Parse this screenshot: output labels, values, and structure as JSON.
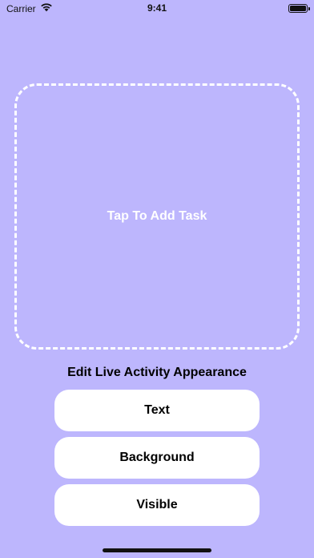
{
  "status_bar": {
    "carrier": "Carrier",
    "time": "9:41",
    "wifi_icon": "wifi-icon",
    "battery_icon": "battery-icon"
  },
  "drop_zone": {
    "label": "Tap To Add Task"
  },
  "appearance": {
    "title": "Edit Live Activity Appearance",
    "buttons": [
      {
        "label": "Text"
      },
      {
        "label": "Background"
      },
      {
        "label": "Visible"
      }
    ]
  },
  "colors": {
    "background": "#bdb6fd",
    "dashed_border": "#ffffff",
    "button_fill": "#ffffff",
    "text": "#000000"
  }
}
